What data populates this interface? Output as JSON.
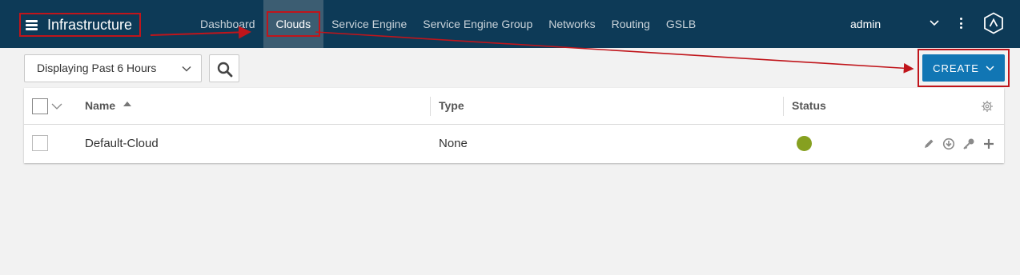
{
  "app": {
    "title": "Infrastructure"
  },
  "nav": {
    "items": [
      {
        "label": "Dashboard",
        "active": false
      },
      {
        "label": "Clouds",
        "active": true
      },
      {
        "label": "Service Engine",
        "active": false
      },
      {
        "label": "Service Engine Group",
        "active": false
      },
      {
        "label": "Networks",
        "active": false
      },
      {
        "label": "Routing",
        "active": false
      },
      {
        "label": "GSLB",
        "active": false
      }
    ]
  },
  "user": {
    "name": "admin"
  },
  "toolbar": {
    "range_value": "Displaying Past 6 Hours",
    "create_label": "CREATE"
  },
  "grid": {
    "columns": [
      {
        "label": "Name",
        "sort": "ascending"
      },
      {
        "label": "Type"
      },
      {
        "label": "Status"
      }
    ],
    "rows": [
      {
        "name": "Default-Cloud",
        "type": "None",
        "status": "up"
      }
    ]
  },
  "colors": {
    "topbar": "#0d3a57",
    "active_nav": "#3c5d72",
    "primary_button": "#1176b4",
    "status_up": "#86a020",
    "annotation": "#c0151b"
  },
  "icons": {
    "menu": "hamburger-icon",
    "search": "search-icon",
    "user_menu": "chevron-down-icon",
    "more": "kebab-icon",
    "logo": "avi-logo-icon",
    "settings": "gear-icon",
    "row_actions": [
      "pencil-icon",
      "download-icon",
      "key-icon",
      "plus-icon"
    ]
  }
}
